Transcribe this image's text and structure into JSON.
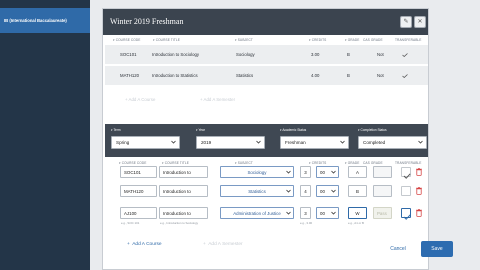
{
  "sidebar": {
    "clipped_text": "...",
    "active_item": "IB (International Baccalaureate)"
  },
  "term_card": {
    "title": "Winter 2019 Freshman",
    "header_buttons": [
      "edit-icon",
      "close-icon"
    ],
    "columns": [
      "Course Code",
      "Course Title",
      "Subject",
      "Credits",
      "Grade",
      "Cas Grade",
      "Transferable"
    ],
    "saved_rows": [
      {
        "code": "SOC101",
        "title": "Introduction to Sociology",
        "subject": "Sociology",
        "credits": "3.00",
        "grade": "B",
        "cas_grade": "Not"
      },
      {
        "code": "MATH120",
        "title": "Introduction to Statistics",
        "subject": "Statistics",
        "credits": "4.00",
        "grade": "B",
        "cas_grade": "Not"
      }
    ],
    "add_course_label": "Add A Course",
    "add_semester_label": "Add A Semester"
  },
  "filters": {
    "term_label": "Term",
    "term_value": "Spring",
    "year_label": "Year",
    "year_value": "2019",
    "academic_status_label": "Academic Status",
    "academic_status_value": "Freshman",
    "completion_status_label": "Completion Status",
    "completion_status_value": "Completed"
  },
  "edit_grid": {
    "columns": [
      "Course Code",
      "Course Title",
      "Subject",
      "Credits",
      "Grade",
      "Cas Grade",
      "Transferable"
    ],
    "rows": [
      {
        "code": "SOC101",
        "title": "Introduction to",
        "subject": "Sociology",
        "credits": "3",
        "credits_fraction": "00",
        "grade": "A"
      },
      {
        "code": "MATH120",
        "title": "Introduction to",
        "subject": "Statistics",
        "credits": "4",
        "credits_fraction": "00",
        "grade": "B"
      },
      {
        "code": "AJ100",
        "title": "Introduction to",
        "subject": "Administration of Justice",
        "credits": "3",
        "credits_fraction": "00",
        "grade": "W",
        "cas_grade": "Pass"
      }
    ],
    "hints": {
      "code": "e.g., SOC 101",
      "title": "e.g., Introduction to Sociology",
      "credits": "e.g., 3.00",
      "grade": "e.g., A1 or B"
    },
    "add_course_label": "Add A Course",
    "add_semester_label": "Add A Semester"
  },
  "actions": {
    "cancel_label": "Cancel",
    "save_label": "Save"
  },
  "colors": {
    "sidebar_bg": "#233548",
    "sidebar_active": "#2f6aa8",
    "card_header": "#3b444f",
    "filter_bar": "#3f4853",
    "primary": "#2d6cb0",
    "delete_red": "#d64545"
  }
}
